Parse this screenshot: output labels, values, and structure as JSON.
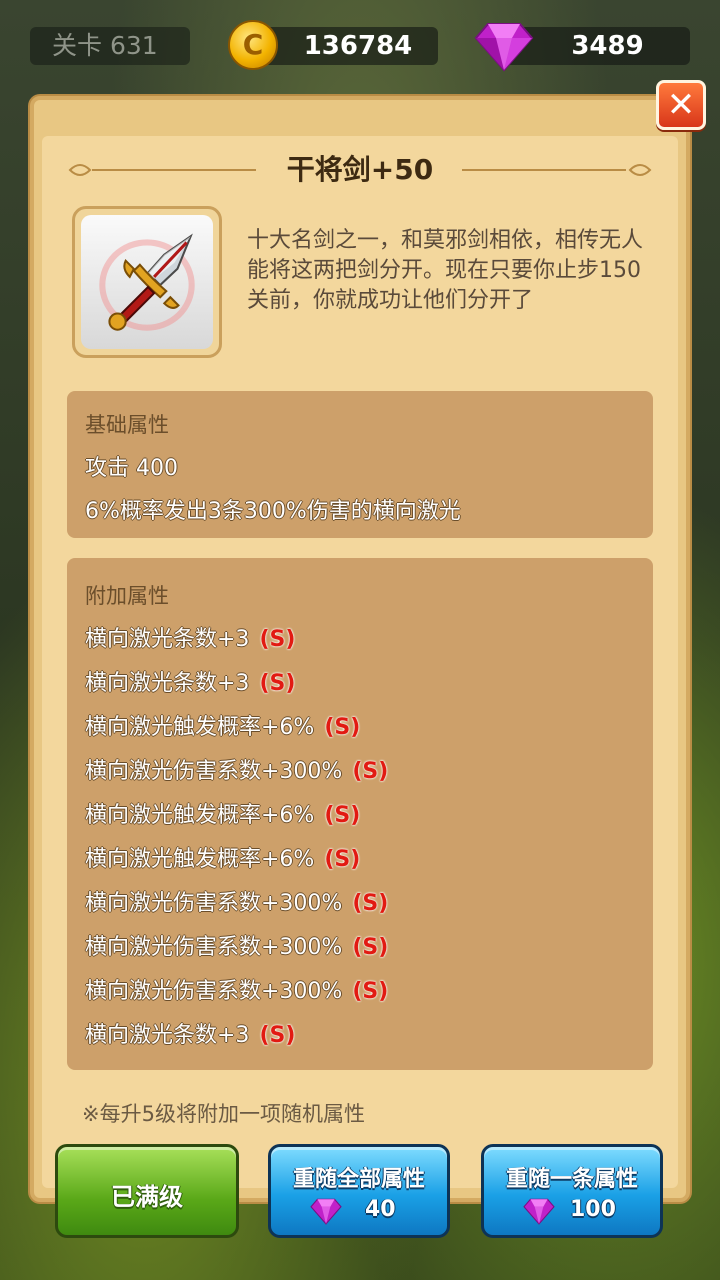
{
  "topbar": {
    "level_label": "关卡 631",
    "coins": "136784",
    "gems": "3489"
  },
  "panel": {
    "title": "干将剑+50",
    "description": "十大名剑之一，和莫邪剑相依，相传无人能将这两把剑分开。现在只要你止步150关前，你就成功让他们分开了",
    "basic": {
      "header": "基础属性",
      "lines": [
        "攻击 400",
        "6%概率发出3条300%伤害的横向激光"
      ]
    },
    "extra": {
      "header": "附加属性",
      "stats": [
        {
          "text": "横向激光条数+3",
          "grade": "(S)"
        },
        {
          "text": "横向激光条数+3",
          "grade": "(S)"
        },
        {
          "text": "横向激光触发概率+6%",
          "grade": "(S)"
        },
        {
          "text": "横向激光伤害系数+300%",
          "grade": "(S)"
        },
        {
          "text": "横向激光触发概率+6%",
          "grade": "(S)"
        },
        {
          "text": "横向激光触发概率+6%",
          "grade": "(S)"
        },
        {
          "text": "横向激光伤害系数+300%",
          "grade": "(S)"
        },
        {
          "text": "横向激光伤害系数+300%",
          "grade": "(S)"
        },
        {
          "text": "横向激光伤害系数+300%",
          "grade": "(S)"
        },
        {
          "text": "横向激光条数+3",
          "grade": "(S)"
        }
      ]
    },
    "note": "※每升5级将附加一项随机属性"
  },
  "buttons": {
    "maxed_label": "已满级",
    "reroll_all_label": "重随全部属性",
    "reroll_all_cost": "40",
    "reroll_one_label": "重随一条属性",
    "reroll_one_cost": "100"
  },
  "icons": {
    "coin": "coin-icon",
    "gem": "gem-icon",
    "close": "close-icon",
    "item": "sword-icon"
  },
  "colors": {
    "grade_s": "#e21a12",
    "panel_bg": "#f3d79d",
    "section_bg": "#cda06a"
  }
}
